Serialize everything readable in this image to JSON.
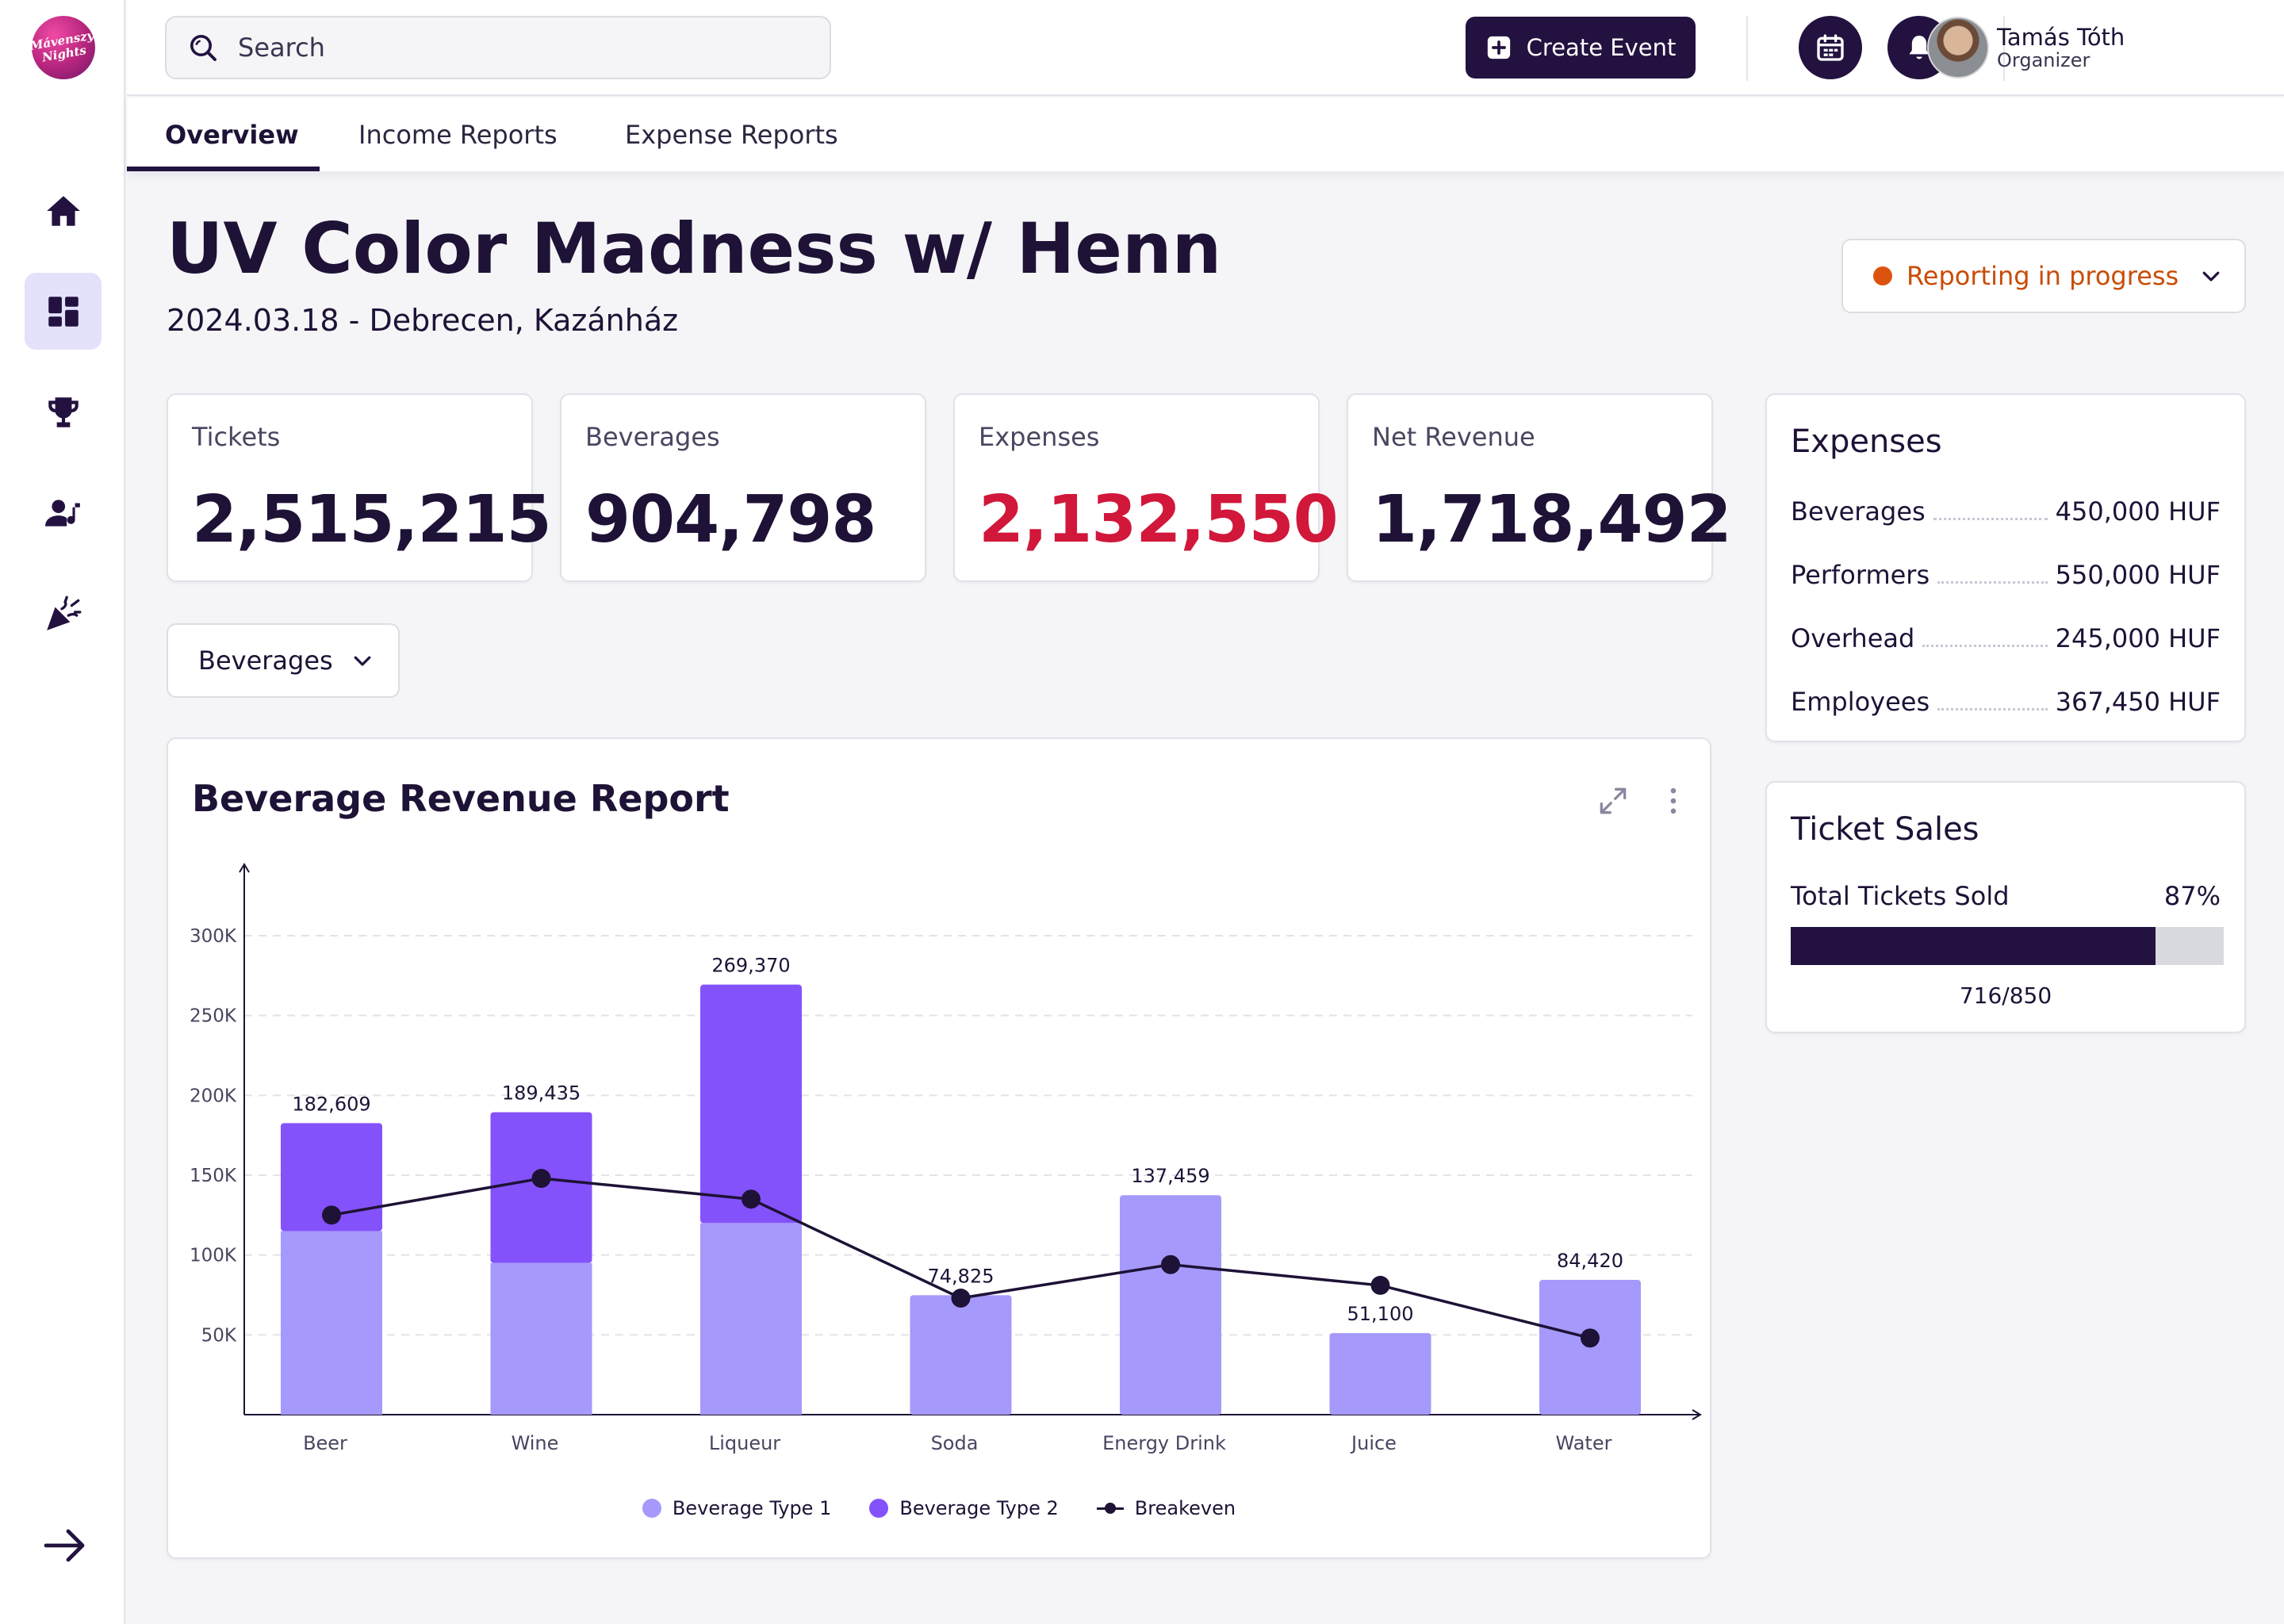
{
  "app": {
    "logo_text_1": "Mávenszy",
    "logo_text_2": "Nights"
  },
  "sidebar": {
    "items": [
      {
        "icon": "home-icon",
        "active": false
      },
      {
        "icon": "dashboard-icon",
        "active": true
      },
      {
        "icon": "trophy-icon",
        "active": false
      },
      {
        "icon": "performer-icon",
        "active": false
      },
      {
        "icon": "party-popper-icon",
        "active": false
      }
    ],
    "expand_icon": "arrow-right-icon"
  },
  "header": {
    "search_placeholder": "Search",
    "create_button": "Create Event",
    "user": {
      "name": "Tamás Tóth",
      "role": "Organizer"
    }
  },
  "tabs": [
    {
      "label": "Overview",
      "active": true
    },
    {
      "label": "Income Reports",
      "active": false
    },
    {
      "label": "Expense Reports",
      "active": false
    }
  ],
  "event": {
    "title": "UV Color Madness w/ Henn",
    "subtitle": "2024.03.18 - Debrecen, Kazánház",
    "status": "Reporting in progress",
    "status_color": "#dc5310"
  },
  "stats": [
    {
      "label": "Tickets",
      "value": "2,515,215",
      "negative": false
    },
    {
      "label": "Beverages",
      "value": "904,798",
      "negative": false
    },
    {
      "label": "Expenses",
      "value": "2,132,550",
      "negative": true
    },
    {
      "label": "Net Revenue",
      "value": "1,718,492",
      "negative": false
    }
  ],
  "filter": {
    "selected": "Beverages"
  },
  "chart": {
    "title": "Beverage Revenue Report"
  },
  "chart_data": {
    "type": "bar",
    "stacked": true,
    "categories": [
      "Beer",
      "Wine",
      "Liqueur",
      "Soda",
      "Energy Drink",
      "Juice",
      "Water"
    ],
    "series": [
      {
        "name": "Beverage Type 1",
        "color": "#a599fb",
        "values": [
          115000,
          95000,
          120000,
          74825,
          137459,
          51100,
          84420
        ]
      },
      {
        "name": "Beverage Type 2",
        "color": "#8452fb",
        "values": [
          67609,
          94435,
          149370,
          0,
          0,
          0,
          0
        ]
      },
      {
        "name": "Breakeven",
        "type": "line",
        "color": "#1e1236",
        "values": [
          125000,
          148000,
          135000,
          73000,
          94000,
          81000,
          48000
        ]
      }
    ],
    "totals_labels": [
      "182,609",
      "189,435",
      "269,370",
      "74,825",
      "137,459",
      "51,100",
      "84,420"
    ],
    "y_ticks": [
      50000,
      100000,
      150000,
      200000,
      250000,
      300000
    ],
    "y_tick_labels": [
      "50K",
      "100K",
      "150K",
      "200K",
      "250K",
      "300K"
    ],
    "ylim": [
      0,
      325000
    ],
    "grid": true,
    "legend_position": "bottom"
  },
  "expenses": {
    "title": "Expenses",
    "rows": [
      {
        "label": "Beverages",
        "value": "450,000 HUF"
      },
      {
        "label": "Performers",
        "value": "550,000 HUF"
      },
      {
        "label": "Overhead",
        "value": "245,000 HUF"
      },
      {
        "label": "Employees",
        "value": "367,450 HUF"
      }
    ]
  },
  "tickets": {
    "title": "Ticket Sales",
    "label": "Total Tickets Sold",
    "percent_text": "87%",
    "sold_fraction": 0.842,
    "count_text": "716/850"
  }
}
